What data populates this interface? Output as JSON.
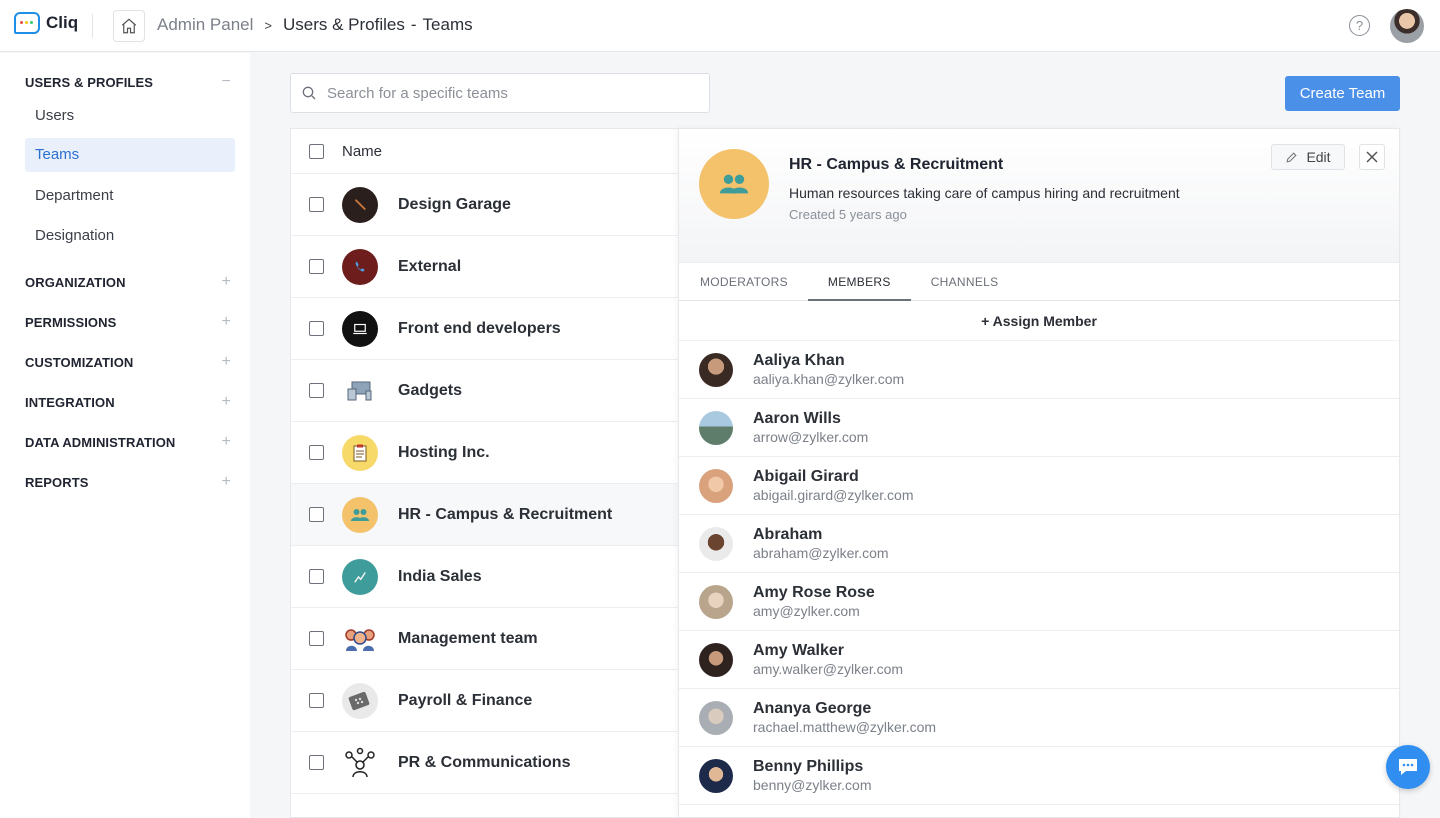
{
  "app": {
    "name": "Cliq"
  },
  "breadcrumb": {
    "root": "Admin Panel",
    "separator": ">",
    "current": "Users & Profiles",
    "dash": "-",
    "page": "Teams"
  },
  "sidebar": {
    "sections": [
      {
        "label": "USERS & PROFILES",
        "sign": "−",
        "expanded": true
      },
      {
        "label": "ORGANIZATION",
        "sign": "+"
      },
      {
        "label": "PERMISSIONS",
        "sign": "+"
      },
      {
        "label": "CUSTOMIZATION",
        "sign": "+"
      },
      {
        "label": "INTEGRATION",
        "sign": "+"
      },
      {
        "label": "DATA ADMINISTRATION",
        "sign": "+"
      },
      {
        "label": "REPORTS",
        "sign": "+"
      }
    ],
    "sub_items": [
      {
        "label": "Users"
      },
      {
        "label": "Teams",
        "active": true
      },
      {
        "label": "Department"
      },
      {
        "label": "Designation"
      }
    ]
  },
  "search": {
    "placeholder": "Search for a specific teams"
  },
  "create_button": {
    "label": "Create Team"
  },
  "team_list": {
    "header": "Name",
    "teams": [
      {
        "name": "Design Garage",
        "color": "#2a1f1c"
      },
      {
        "name": "External",
        "color": "#6e1d1d"
      },
      {
        "name": "Front end developers",
        "color": "#111111"
      },
      {
        "name": "Gadgets",
        "color": "#ffffff"
      },
      {
        "name": "Hosting Inc.",
        "color": "#f7d96a"
      },
      {
        "name": "HR - Campus & Recruitment",
        "color": "#f3c26b",
        "selected": true
      },
      {
        "name": "India Sales",
        "color": "#3e9c9a"
      },
      {
        "name": "Management team",
        "color": "#ffffff"
      },
      {
        "name": "Payroll & Finance",
        "color": "#e9e9e9"
      },
      {
        "name": "PR & Communications",
        "color": "#ffffff"
      }
    ]
  },
  "detail": {
    "title": "HR - Campus & Recruitment",
    "description": "Human resources taking care of campus hiring and recruitment",
    "created": "Created 5 years ago",
    "edit_label": "Edit",
    "tabs": [
      {
        "label": "MODERATORS"
      },
      {
        "label": "MEMBERS",
        "active": true
      },
      {
        "label": "CHANNELS"
      }
    ],
    "assign_label": "+ Assign Member",
    "members": [
      {
        "name": "Aaliya Khan",
        "email": "aaliya.khan@zylker.com",
        "color": "#3a2a24"
      },
      {
        "name": "Aaron Wills",
        "email": "arrow@zylker.com",
        "color": "#7fa7c4"
      },
      {
        "name": "Abigail Girard",
        "email": "abigail.girard@zylker.com",
        "color": "#d9a27c"
      },
      {
        "name": "Abraham",
        "email": "abraham@zylker.com",
        "color": "#5b3b2b"
      },
      {
        "name": "Amy Rose Rose",
        "email": "amy@zylker.com",
        "color": "#c8b49b"
      },
      {
        "name": "Amy Walker",
        "email": "amy.walker@zylker.com",
        "color": "#2f2320"
      },
      {
        "name": "Ananya George",
        "email": "rachael.matthew@zylker.com",
        "color": "#a9adb4"
      },
      {
        "name": "Benny Phillips",
        "email": "benny@zylker.com",
        "color": "#1d2a4a"
      }
    ]
  },
  "colors": {
    "accent": "#4a90e8",
    "active_nav_bg": "#e9f0fb",
    "active_nav_text": "#2c6fd1"
  }
}
